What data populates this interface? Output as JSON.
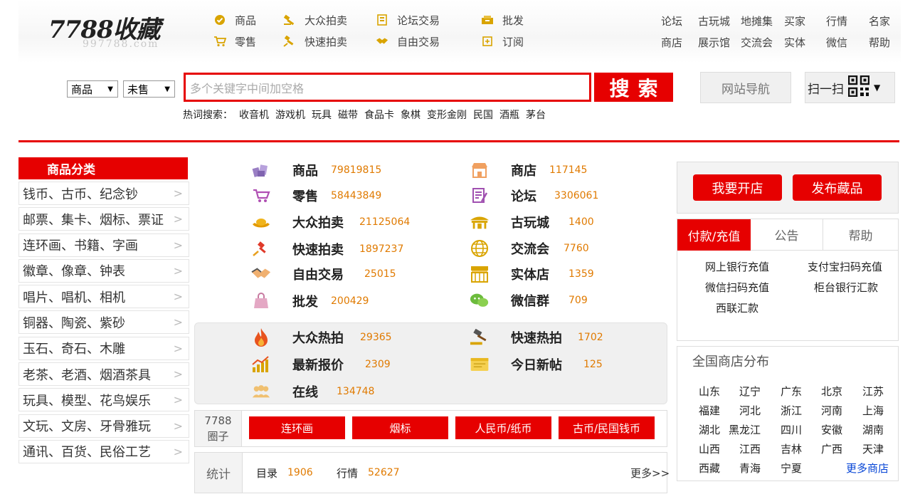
{
  "logo": {
    "main": "7788收藏",
    "sub": "997788.com"
  },
  "topnav": [
    {
      "label": "商品",
      "icon": "check-badge-icon"
    },
    {
      "label": "大众拍卖",
      "icon": "gavel-icon"
    },
    {
      "label": "论坛交易",
      "icon": "document-icon"
    },
    {
      "label": "批发",
      "icon": "box-icon"
    },
    {
      "label": "零售",
      "icon": "cart-icon"
    },
    {
      "label": "快速拍卖",
      "icon": "fast-gavel-icon"
    },
    {
      "label": "自由交易",
      "icon": "handshake-icon"
    },
    {
      "label": "订阅",
      "icon": "subscribe-icon"
    }
  ],
  "rightnav": {
    "row1": [
      "论坛",
      "古玩城",
      "地摊集",
      "买家",
      "行情",
      "名家"
    ],
    "row2": [
      "商店",
      "展示馆",
      "交流会",
      "实体",
      "微信",
      "帮助"
    ]
  },
  "search": {
    "select1": "商品",
    "select2": "未售",
    "placeholder": "多个关键字中间加空格",
    "button": "搜索",
    "site_nav": "网站导航",
    "scan": "扫一扫"
  },
  "hot": {
    "label": "热词搜索：",
    "keywords": [
      "收音机",
      "游戏机",
      "玩具",
      "磁带",
      "食品卡",
      "象棋",
      "变形金刚",
      "民国",
      "酒瓶",
      "茅台"
    ]
  },
  "categories": {
    "title": "商品分类",
    "items": [
      "钱币、古币、纪念钞",
      "邮票、集卡、烟标、票证",
      "连环画、书籍、字画",
      "徽章、像章、钟表",
      "唱片、唱机、相机",
      "铜器、陶瓷、紫砂",
      "玉石、奇石、木雕",
      "老茶、老酒、烟酒茶具",
      "玩具、模型、花鸟娱乐",
      "文玩、文房、牙骨雅玩",
      "通讯、百货、民俗工艺"
    ]
  },
  "stats": [
    {
      "name": "商品",
      "value": "79819815",
      "icon": "goods-icon"
    },
    {
      "name": "零售",
      "value": "58443849",
      "icon": "cart-icon"
    },
    {
      "name": "大众拍卖",
      "value": "21125064",
      "icon": "gold-ingot-icon"
    },
    {
      "name": "快速拍卖",
      "value": "1897237",
      "icon": "fast-gavel-icon"
    },
    {
      "name": "自由交易",
      "value": "25015",
      "icon": "handshake-icon"
    },
    {
      "name": "批发",
      "value": "200429",
      "icon": "bag-icon"
    },
    {
      "name": "商店",
      "value": "117145",
      "icon": "shop-icon"
    },
    {
      "name": "论坛",
      "value": "3306061",
      "icon": "forum-icon"
    },
    {
      "name": "古玩城",
      "value": "1400",
      "icon": "pavilion-icon"
    },
    {
      "name": "交流会",
      "value": "7760",
      "icon": "globe-icon"
    },
    {
      "name": "实体店",
      "value": "1359",
      "icon": "storefront-icon"
    },
    {
      "name": "微信群",
      "value": "709",
      "icon": "wechat-icon"
    }
  ],
  "hotstats": [
    {
      "name": "大众热拍",
      "value": "29365",
      "icon": "fire-icon"
    },
    {
      "name": "最新报价",
      "value": "2309",
      "icon": "bar-chart-icon"
    },
    {
      "name": "在线",
      "value": "134748",
      "icon": "users-icon"
    },
    {
      "name": "快速热拍",
      "value": "1702",
      "icon": "gavel-icon"
    },
    {
      "name": "今日新帖",
      "value": "125",
      "icon": "note-icon"
    }
  ],
  "circle": {
    "label_line1": "7788",
    "label_line2": "圈子",
    "buttons": [
      "连环画",
      "烟标",
      "人民币/纸币",
      "古币/民国钱币"
    ]
  },
  "tongji": {
    "label": "统计",
    "items": [
      {
        "name": "目录",
        "value": "1906"
      },
      {
        "name": "行情",
        "value": "52627"
      }
    ],
    "more": "更多>>"
  },
  "right": {
    "open_shop": "我要开店",
    "publish": "发布藏品",
    "tabs": [
      "付款/充值",
      "公告",
      "帮助"
    ],
    "payments": [
      "网上银行充值",
      "支付宝扫码充值",
      "微信扫码充值",
      "柜台银行汇款",
      "西联汇款"
    ],
    "prov_title": "全国商店分布",
    "provinces": [
      "山东",
      "辽宁",
      "广东",
      "北京",
      "江苏",
      "福建",
      "河北",
      "浙江",
      "河南",
      "上海",
      "湖北",
      "黑龙江",
      "四川",
      "安徽",
      "湖南",
      "山西",
      "江西",
      "吉林",
      "广西",
      "天津",
      "西藏",
      "青海",
      "宁夏"
    ],
    "more_shops": "更多商店"
  },
  "colors": {
    "accent": "#e60000",
    "number": "#e07a00",
    "link": "#0645d6"
  }
}
